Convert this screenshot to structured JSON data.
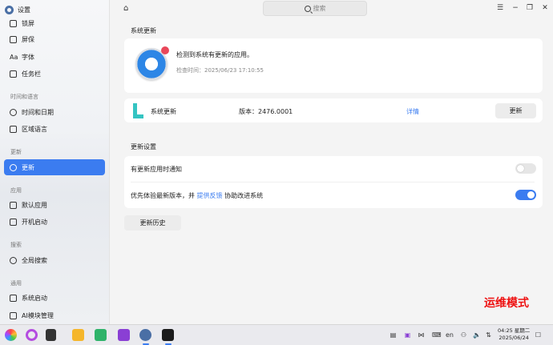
{
  "app": {
    "title": "设置"
  },
  "sidebar": {
    "items": [
      {
        "label": "锁屏"
      },
      {
        "label": "屏保"
      },
      {
        "label": "字体"
      },
      {
        "label": "任务栏"
      },
      {
        "label": "时间和日期"
      },
      {
        "label": "区域语言"
      },
      {
        "label": "更新"
      },
      {
        "label": "默认应用"
      },
      {
        "label": "开机启动"
      },
      {
        "label": "全局搜索"
      },
      {
        "label": "系统启动"
      },
      {
        "label": "AI模块管理"
      }
    ],
    "sections": {
      "time_lang": "时间和语言",
      "update": "更新",
      "apps": "应用",
      "search": "搜索",
      "general": "通用"
    }
  },
  "header": {
    "search_placeholder": "搜索"
  },
  "main": {
    "update_title": "系统更新",
    "check_msg": "检测到系统有更新的应用。",
    "check_time": "检查时间：2025/06/23 17:10:55",
    "update_row": {
      "name": "系统更新",
      "version": "版本：2476.0001",
      "details": "详情",
      "button": "更新"
    },
    "settings_title": "更新设置",
    "notify_label": "有更新应用时通知",
    "notify_on": false,
    "preview_prefix": "优先体验最新版本，并",
    "preview_link": "提供反馈",
    "preview_suffix": "协助改进系统",
    "preview_on": true,
    "history_button": "更新历史"
  },
  "overlay": {
    "mode_text": "运维模式"
  },
  "taskbar": {
    "time": "04:25 星期二",
    "date": "2025/06/24",
    "lang": "en"
  },
  "colors": {
    "accent": "#3b7cf0",
    "mode_red": "#e11111"
  }
}
